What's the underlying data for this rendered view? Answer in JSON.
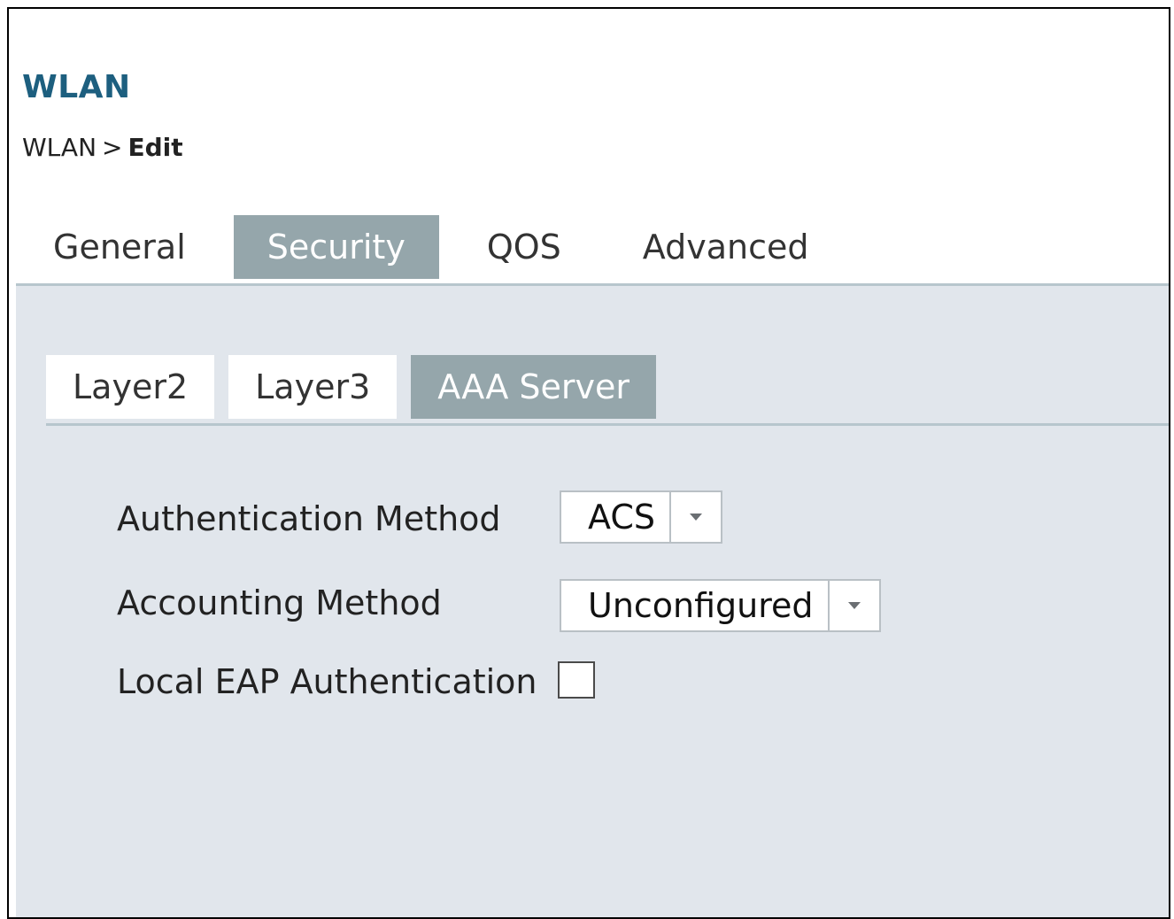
{
  "header": {
    "title": "WLAN",
    "breadcrumb": {
      "root": "WLAN",
      "separator": ">",
      "current": "Edit"
    }
  },
  "tabs": [
    {
      "label": "General",
      "active": false
    },
    {
      "label": "Security",
      "active": true
    },
    {
      "label": "QOS",
      "active": false
    },
    {
      "label": "Advanced",
      "active": false
    }
  ],
  "subtabs": [
    {
      "label": "Layer2",
      "active": false
    },
    {
      "label": "Layer3",
      "active": false
    },
    {
      "label": "AAA Server",
      "active": true
    }
  ],
  "form": {
    "authentication_method": {
      "label": "Authentication Method",
      "value": "ACS",
      "icon": "chevron-down-icon"
    },
    "accounting_method": {
      "label": "Accounting Method",
      "value": "Unconfigured",
      "icon": "chevron-down-icon"
    },
    "local_eap": {
      "label": "Local EAP Authentication",
      "checked": false
    }
  },
  "colors": {
    "title": "#1d5f7f",
    "active_tab": "#95a6ab",
    "panel_bg": "#e1e6ec"
  }
}
